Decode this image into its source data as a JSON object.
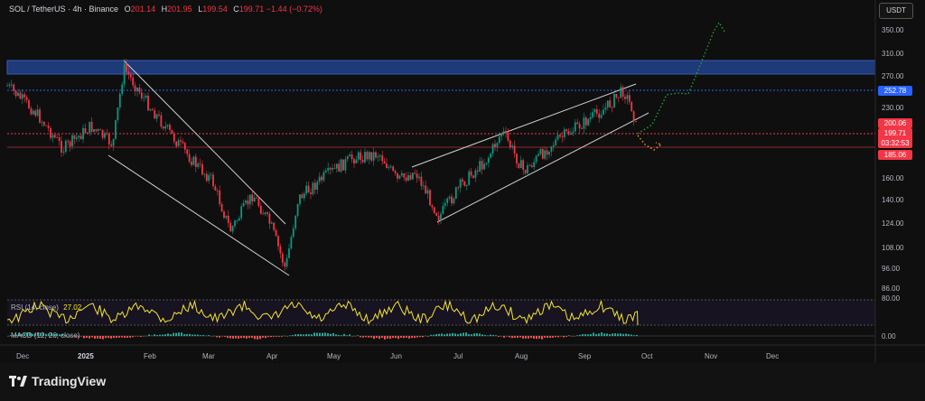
{
  "header": {
    "symbol": "SOL / TetherUS · 4h · Binance",
    "open_label": "O",
    "open": "201.14",
    "high_label": "H",
    "high": "201.95",
    "low_label": "L",
    "low": "199.54",
    "close_label": "C",
    "close": "199.71",
    "change": "−1.44 (−0.72%)"
  },
  "toolbar": {
    "currency": "USDT"
  },
  "colors": {
    "up": "#089981",
    "down": "#f23645",
    "blue_line": "#2962ff",
    "zone": "#1e3a78",
    "rsi": "#f5e52b",
    "projection": "#26a641",
    "projection_down": "#f5a623"
  },
  "price_axis": {
    "ticks": [
      "350.00",
      "310.00",
      "270.00",
      "230.00",
      "200.00",
      "185.00",
      "160.00",
      "140.00",
      "124.00",
      "108.00",
      "96.00",
      "86.00"
    ],
    "badges": {
      "blue": "252.78",
      "red_top": "200.06",
      "current": "199.71",
      "countdown": "03:32:53",
      "red_bottom": "185.06"
    }
  },
  "time_axis": {
    "ticks": [
      "Dec",
      "2025",
      "Feb",
      "Mar",
      "Apr",
      "May",
      "Jun",
      "Jul",
      "Aug",
      "Sep",
      "Oct",
      "Nov",
      "Dec"
    ]
  },
  "rsi_panel": {
    "label": "RSI (14, close)",
    "value": "27.02",
    "level": "80.00"
  },
  "macd_panel": {
    "label": "MACD (12, 26, close)",
    "level": "0.00"
  },
  "footer": {
    "brand": "TradingView"
  }
}
